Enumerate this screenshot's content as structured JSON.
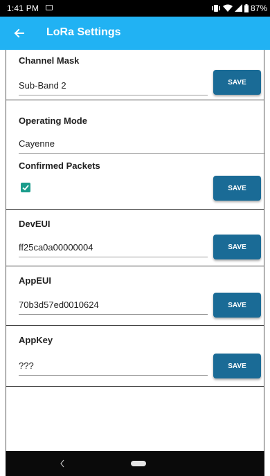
{
  "status_bar": {
    "time": "1:41 PM",
    "battery": "87%",
    "icons": [
      "image-icon",
      "vibrate-icon",
      "wifi-icon",
      "signal-icon",
      "battery-icon"
    ]
  },
  "app_bar": {
    "title": "LoRa Settings",
    "back_icon": "arrow-left-icon",
    "color": "#21b2f3"
  },
  "sections": {
    "channel_mask": {
      "label": "Channel Mask",
      "value": "Sub-Band 2",
      "save": "SAVE"
    },
    "operating_mode": {
      "label": "Operating Mode",
      "value": "Cayenne"
    },
    "confirmed_packets": {
      "label": "Confirmed Packets",
      "checked": true,
      "save": "SAVE"
    },
    "dev_eui": {
      "label": "DevEUI",
      "value": "ff25ca0a00000004",
      "save": "SAVE"
    },
    "app_eui": {
      "label": "AppEUI",
      "value": "70b3d57ed0010624",
      "save": "SAVE"
    },
    "app_key": {
      "label": "AppKey",
      "value": "???",
      "save": "SAVE"
    }
  },
  "colors": {
    "save_button": "#1a6b96",
    "checkbox": "#1a9c8b"
  },
  "nav_bar": {
    "icons": [
      "nav-back-icon",
      "home-pill-icon"
    ]
  }
}
